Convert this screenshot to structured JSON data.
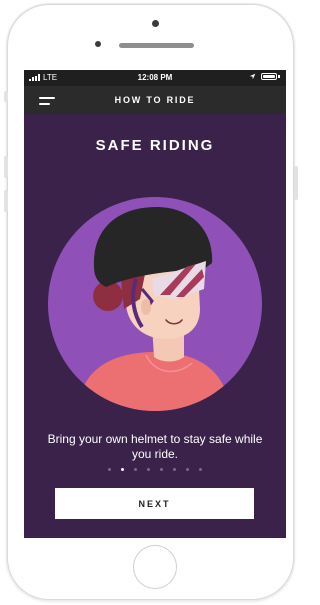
{
  "status": {
    "carrier": "LTE",
    "time": "12:08 PM"
  },
  "nav": {
    "title": "HOW TO RIDE",
    "menu_icon": "hamburger-menu-icon"
  },
  "page": {
    "title": "SAFE RIDING"
  },
  "caption": "Bring your own helmet to stay safe while you ride.",
  "pagination": {
    "total": 8,
    "current": 2
  },
  "next_button": {
    "label": "NEXT"
  },
  "colors": {
    "background": "#3a224a",
    "circle": "#8f51b8",
    "status_bar": "#1f1f1f",
    "nav_bar": "#2b2b2b",
    "button": "#ffffff"
  }
}
